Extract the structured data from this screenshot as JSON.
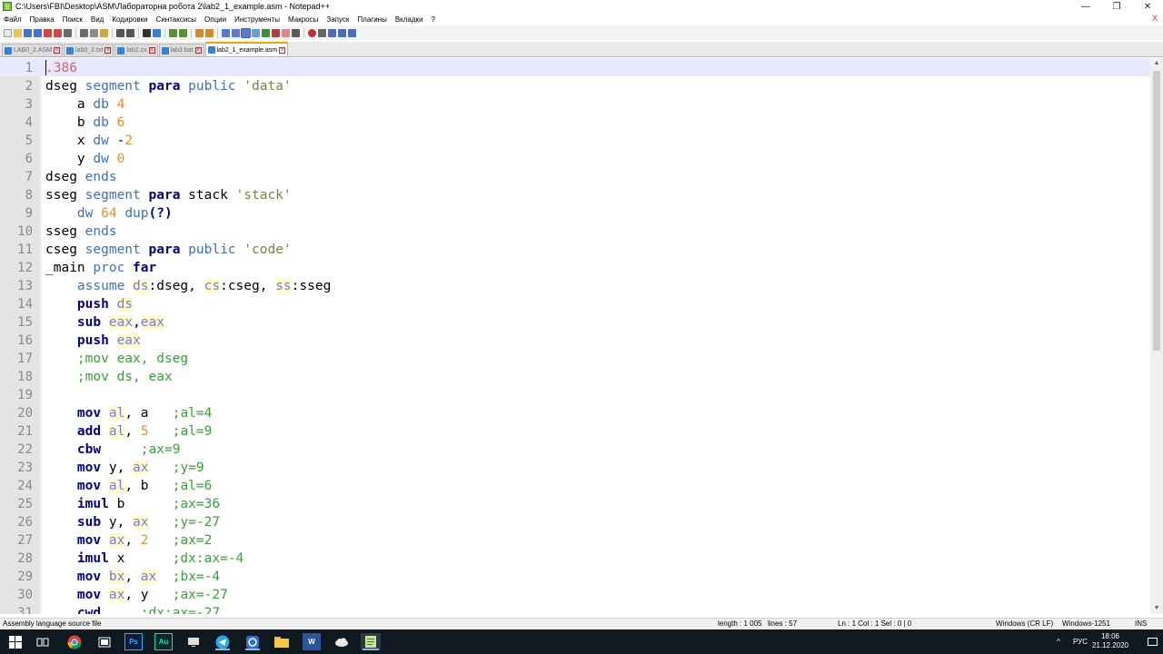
{
  "window": {
    "title": "C:\\Users\\FBI\\Desktop\\ASM\\Лабораторна робота 2\\lab2_1_example.asm - Notepad++",
    "controls": [
      "—",
      "❐",
      "✕"
    ]
  },
  "menu": [
    "Файл",
    "Правка",
    "Поиск",
    "Вид",
    "Кодировки",
    "Синтаксисы",
    "Опции",
    "Инструменты",
    "Макросы",
    "Запуск",
    "Плагины",
    "Вкладки",
    "?"
  ],
  "menu_close": "X",
  "tabs": [
    {
      "label": "LAB0_2.ASM",
      "active": false
    },
    {
      "label": "lab0_2.txt",
      "active": false
    },
    {
      "label": "lab2.cx",
      "active": false
    },
    {
      "label": "lab3.bat",
      "active": false
    },
    {
      "label": "lab2_1_example.asm",
      "active": true
    }
  ],
  "editor": {
    "line_numbers": [
      "1",
      "2",
      "3",
      "4",
      "5",
      "6",
      "7",
      "8",
      "9",
      "10",
      "11",
      "12",
      "13",
      "14",
      "15",
      "16",
      "17",
      "18",
      "19",
      "20",
      "21",
      "22",
      "23",
      "24",
      "25",
      "26",
      "27",
      "28",
      "29",
      "30",
      "31"
    ]
  },
  "status": {
    "file_type": "Assembly language source file",
    "length": "length : 1 005",
    "lines": "lines : 57",
    "position": "Ln : 1    Col : 1    Sel : 0 | 0",
    "eol": "Windows (CR LF)",
    "encoding": "Windows-1251",
    "mode": "INS"
  },
  "taskbar": {
    "apps": [
      "start-icon",
      "task-view-icon",
      "chrome-icon",
      "media-icon",
      "photoshop-icon",
      "audition-icon",
      "monitor-icon",
      "telegram-icon",
      "terminal-icon",
      "explorer-icon",
      "word-icon",
      "cloud-icon",
      "notepadpp-icon"
    ],
    "photoshop_label": "Ps",
    "audition_label": "Au",
    "word_label": "W",
    "lang": "РУС",
    "time": "18:06",
    "date": "21.12.2020"
  }
}
